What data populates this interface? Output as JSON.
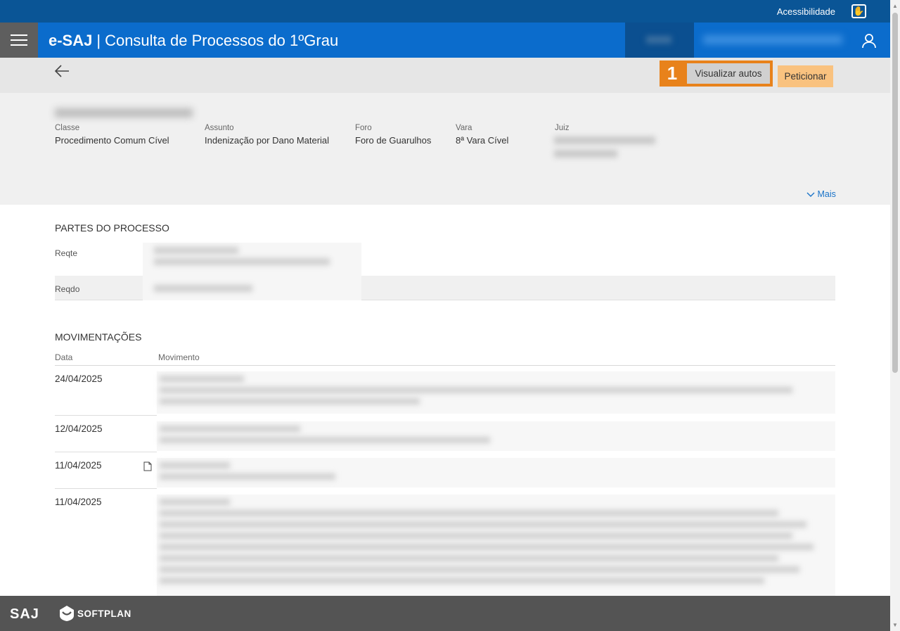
{
  "topbar": {
    "accessibility_label": "Acessibilidade"
  },
  "header": {
    "brand": "e-SAJ",
    "title": "Consulta de Processos do 1ºGrau"
  },
  "toolbar": {
    "step_badge": "1",
    "view_button_label": "Visualizar autos",
    "petition_button_label": "Peticionar"
  },
  "summary": {
    "class_label": "Classe",
    "class_value": "Procedimento Comum Cível",
    "subject_label": "Assunto",
    "subject_value": "Indenização por Dano Material",
    "forum_label": "Foro",
    "forum_value": "Foro de Guarulhos",
    "court_label": "Vara",
    "court_value": "8ª Vara Cível",
    "judge_label": "Juiz",
    "more_label": "Mais"
  },
  "parties": {
    "title": "PARTES DO PROCESSO",
    "rows": [
      {
        "label": "Reqte"
      },
      {
        "label": "Reqdo"
      }
    ]
  },
  "movements": {
    "title": "MOVIMENTAÇÕES",
    "date_header": "Data",
    "movement_header": "Movimento",
    "rows": [
      {
        "date": "24/04/2025"
      },
      {
        "date": "12/04/2025"
      },
      {
        "date": "11/04/2025"
      },
      {
        "date": "11/04/2025"
      }
    ]
  },
  "footer": {
    "saj_logo": "SAJ",
    "softplan_label": "SOFTPLAN"
  },
  "icons": {
    "accessibility": "hand-icon",
    "menu": "hamburger-icon",
    "user": "user-icon",
    "back": "arrow-left-icon",
    "more": "chevron-down-icon",
    "document": "document-icon",
    "softplan": "softplan-logo-icon"
  },
  "colors": {
    "topbar": "#0a5596",
    "header": "#0b6ccc",
    "highlight": "#e8821b",
    "petition": "#f9c27f",
    "link": "#1a73c8",
    "footer": "#545454"
  }
}
